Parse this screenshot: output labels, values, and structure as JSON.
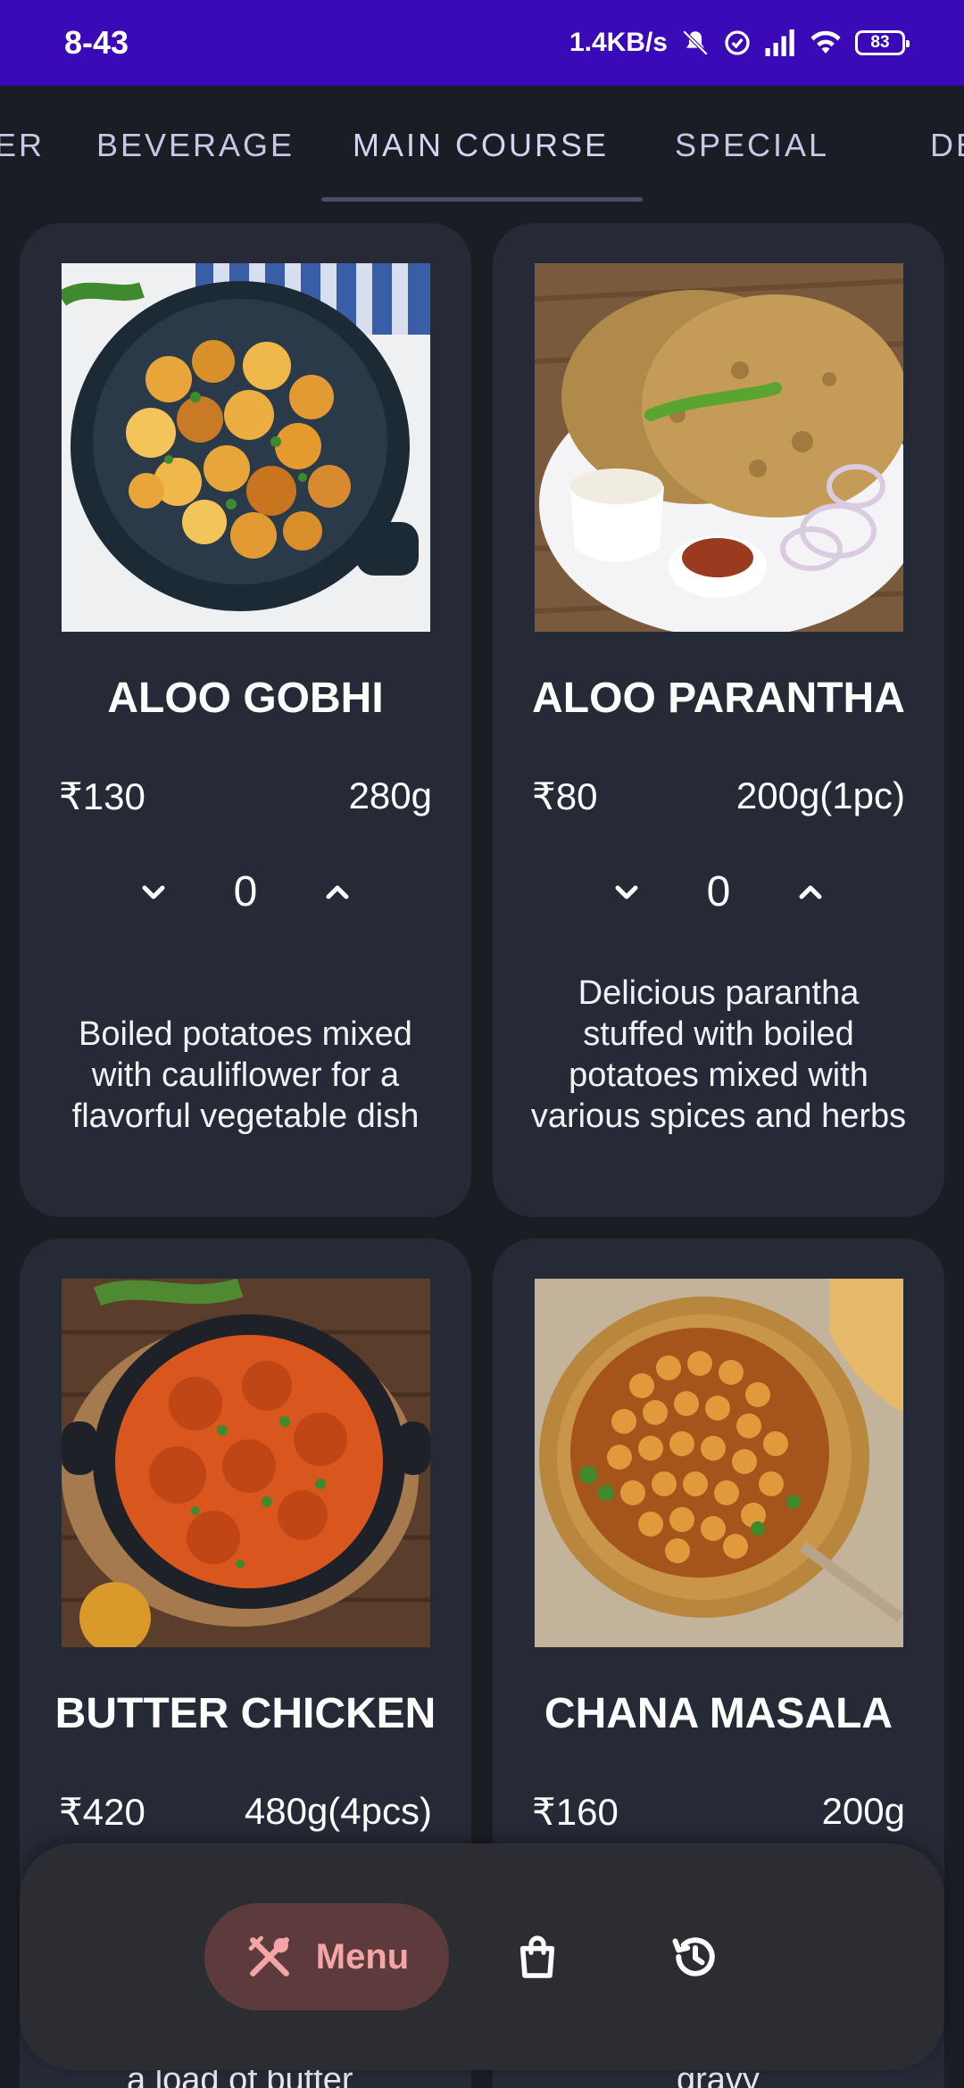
{
  "status_bar": {
    "time": "8-43",
    "network_speed": "1.4KB/s",
    "battery": "83",
    "icons": [
      "mute-icon",
      "vpn-icon",
      "signal-icon",
      "wifi-icon",
      "battery-icon"
    ]
  },
  "tabs": [
    {
      "label": "ER"
    },
    {
      "label": "BEVERAGE"
    },
    {
      "label": "MAIN COURSE",
      "active": true
    },
    {
      "label": "SPECIAL"
    },
    {
      "label": "DES"
    }
  ],
  "items": [
    {
      "name": "ALOO GOBHI",
      "price": "₹130",
      "weight": "280g",
      "quantity": "0",
      "description": "Boiled potatoes mixed with cauliflower for a flavorful vegetable dish"
    },
    {
      "name": "ALOO PARANTHA",
      "price": "₹80",
      "weight": "200g(1pc)",
      "quantity": "0",
      "description": "Delicious parantha stuffed with boiled potatoes mixed with various spices and herbs"
    },
    {
      "name": "BUTTER CHICKEN",
      "price": "₹420",
      "weight": "480g(4pcs)",
      "quantity": "",
      "description": "a load of butter"
    },
    {
      "name": "CHANA MASALA",
      "price": "₹160",
      "weight": "200g",
      "quantity": "",
      "description": "gravy"
    }
  ],
  "bottom_nav": {
    "menu_label": "Menu",
    "accent": "#f4a6a6"
  },
  "colors": {
    "status_bar": "#3a0ab8",
    "background": "#1b1d24",
    "card": "#262a37"
  }
}
